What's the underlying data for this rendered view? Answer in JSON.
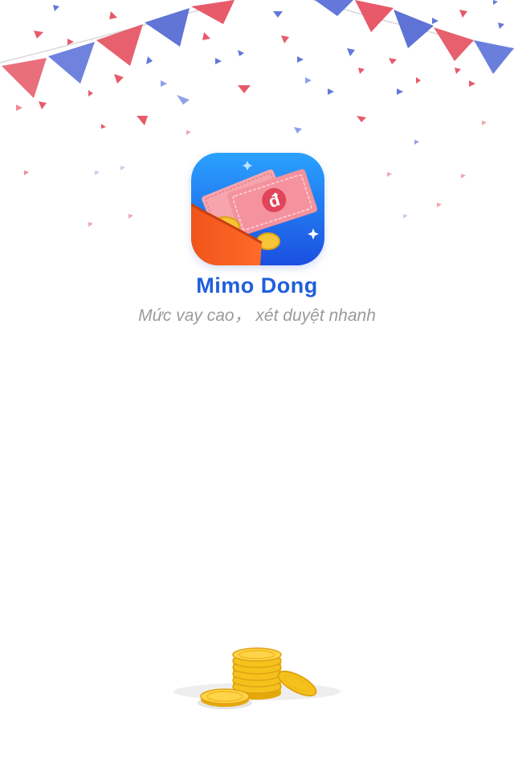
{
  "app": {
    "name": "Mimo Dong",
    "tagline": "Mức vay cao， xét duyệt nhanh",
    "icon": "wallet-money-icon",
    "currency_symbol": "đ"
  },
  "decorations": {
    "banner": "party-bunting",
    "footer": "gold-coin-stack-icon"
  },
  "colors": {
    "brand_blue": "#1e5fdc",
    "flag_red": "#e85a6a",
    "flag_blue": "#5b74d8",
    "tagline_gray": "#9a9a9a",
    "coin_gold": "#f5c21b"
  }
}
